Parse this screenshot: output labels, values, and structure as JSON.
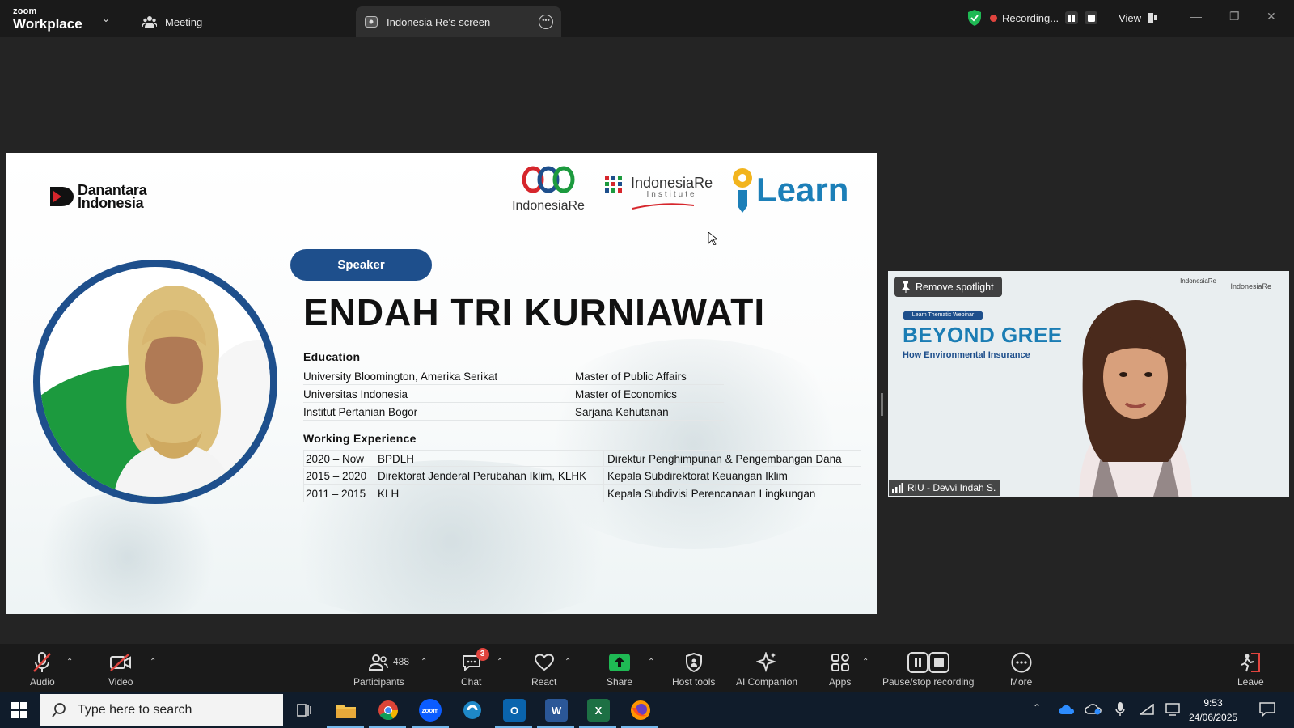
{
  "titlebar": {
    "brand_small": "zoom",
    "brand_main": "Workplace",
    "tab_meeting": "Meeting",
    "tab_screen": "Indonesia Re's screen",
    "recording_label": "Recording...",
    "view_label": "View"
  },
  "slide": {
    "danantara_line1": "Danantara",
    "danantara_line2": "Indonesia",
    "indonesiare_label": "IndonesiaRe",
    "iri_title": "IndonesiaRe",
    "iri_sub": "Institute",
    "ilearn": "Learn",
    "speaker_pill": "Speaker",
    "speaker_name": "ENDAH TRI KURNIAWATI",
    "education_heading": "Education",
    "education": [
      {
        "school": "University Bloomington, Amerika Serikat",
        "degree": "Master of Public Affairs"
      },
      {
        "school": "Universitas Indonesia",
        "degree": "Master of Economics"
      },
      {
        "school": "Institut Pertanian Bogor",
        "degree": "Sarjana Kehutanan"
      }
    ],
    "experience_heading": "Working Experience",
    "experience": [
      {
        "period": "2020 – Now",
        "org": "BPDLH",
        "role": "Direktur Penghimpunan & Pengembangan Dana"
      },
      {
        "period": "2015 – 2020",
        "org": "Direktorat Jenderal Perubahan Iklim, KLHK",
        "role": "Kepala Subdirektorat Keuangan Iklim"
      },
      {
        "period": "2011 – 2015",
        "org": "KLH",
        "role": "Kepala Subdivisi Perencanaan Lingkungan"
      }
    ]
  },
  "video": {
    "remove_spotlight": "Remove spotlight",
    "participant_name": "RIU - Devvi Indah S.",
    "bg_tag": "Learn Thematic Webinar",
    "bg_title": "BEYOND GREE",
    "bg_sub": "How Environmental Insurance",
    "mini_ir": "IndonesiaRe",
    "mini_iri": "IndonesiaRe"
  },
  "toolbar": {
    "audio": "Audio",
    "video": "Video",
    "participants": "Participants",
    "participants_count": "488",
    "chat": "Chat",
    "chat_badge": "3",
    "react": "React",
    "share": "Share",
    "host_tools": "Host tools",
    "ai_companion": "AI Companion",
    "apps": "Apps",
    "pause_stop": "Pause/stop recording",
    "more": "More",
    "leave": "Leave"
  },
  "taskbar": {
    "search_placeholder": "Type here to search",
    "time": "9:53",
    "date": "24/06/2025"
  },
  "colors": {
    "slide_blue": "#1e4f8c",
    "share_green": "#1fb954",
    "record_red": "#e0443e"
  }
}
